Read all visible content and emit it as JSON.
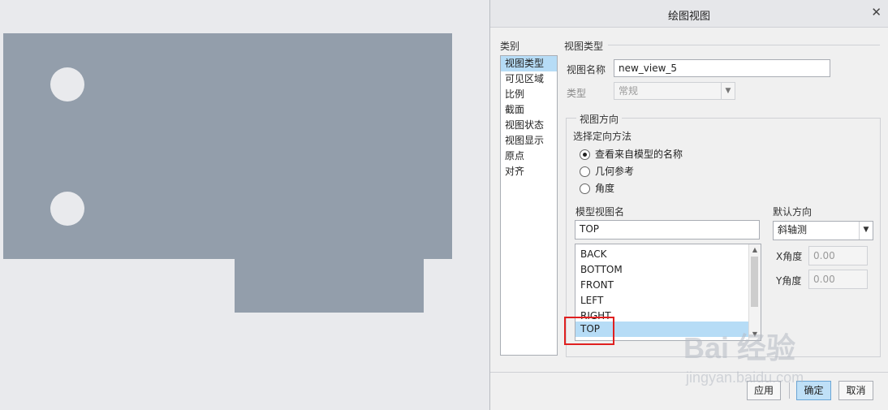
{
  "dialog": {
    "title": "绘图视图",
    "close_icon": "close-icon",
    "categories_label": "类别",
    "categories": [
      {
        "label": "视图类型",
        "selected": true
      },
      {
        "label": "可见区域"
      },
      {
        "label": "比例"
      },
      {
        "label": "截面"
      },
      {
        "label": "视图状态"
      },
      {
        "label": "视图显示"
      },
      {
        "label": "原点"
      },
      {
        "label": "对齐"
      }
    ],
    "view_type_section": "视图类型",
    "view_name_label": "视图名称",
    "view_name_value": "new_view_5",
    "type_label": "类型",
    "type_value": "常规",
    "orientation_section": "视图方向",
    "select_method_label": "选择定向方法",
    "radios": [
      {
        "label": "查看来自模型的名称",
        "checked": true
      },
      {
        "label": "几何参考"
      },
      {
        "label": "角度"
      }
    ],
    "model_view_name_label": "模型视图名",
    "model_view_name_value": "TOP",
    "model_views": [
      "BACK",
      "BOTTOM",
      "FRONT",
      "LEFT",
      "RIGHT",
      "TOP"
    ],
    "selected_model_view": "TOP",
    "default_orientation_label": "默认方向",
    "default_orientation_value": "斜轴测",
    "x_angle_label": "X角度",
    "x_angle_value": "0.00",
    "y_angle_label": "Y角度",
    "y_angle_value": "0.00",
    "buttons": {
      "apply": "应用",
      "ok": "确定",
      "cancel": "取消"
    }
  },
  "watermark": {
    "brand": "Bai 经验",
    "url": "jingyan.baidu.com"
  },
  "colors": {
    "part_fill": "#939eab",
    "selection": "#b6dcf6",
    "highlight": "#e02020"
  }
}
